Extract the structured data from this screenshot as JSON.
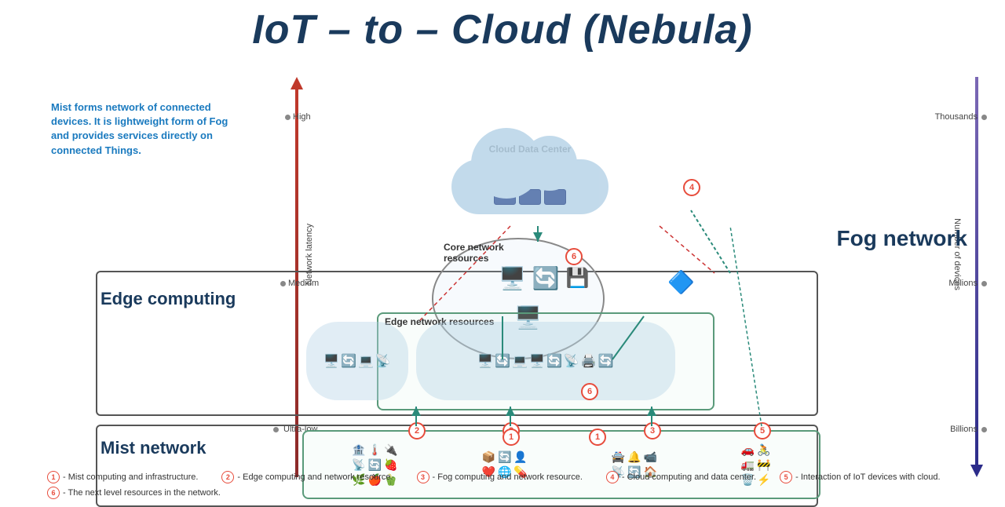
{
  "title": "IoT – to – Cloud (Nebula)",
  "description": "Mist forms network of connected devices. It is lightweight form of Fog and provides services directly on connected Things.",
  "axes": {
    "left_label": "Network latency",
    "right_label": "Number of devices",
    "left_ticks": [
      "High",
      "Medium",
      "Ultra-low"
    ],
    "right_ticks": [
      "Thousands",
      "Millions",
      "Billions"
    ]
  },
  "layers": {
    "fog": "Fog network",
    "edge": "Edge computing",
    "mist": "Mist network"
  },
  "sections": {
    "cloud_label": "Cloud Data Center",
    "core_label": "Core network\nresources",
    "edge_resources_label": "Edge network resources"
  },
  "legend": [
    {
      "num": "1",
      "text": "- Mist computing and infrastructure."
    },
    {
      "num": "2",
      "text": "- Edge computing and network resource."
    },
    {
      "num": "3",
      "text": "- Fog computing and network resource."
    },
    {
      "num": "4",
      "text": "- Cloud computing and data center."
    },
    {
      "num": "5",
      "text": "- Interaction of IoT devices with cloud."
    },
    {
      "num": "6",
      "text": "- The next level resources in the network."
    }
  ]
}
